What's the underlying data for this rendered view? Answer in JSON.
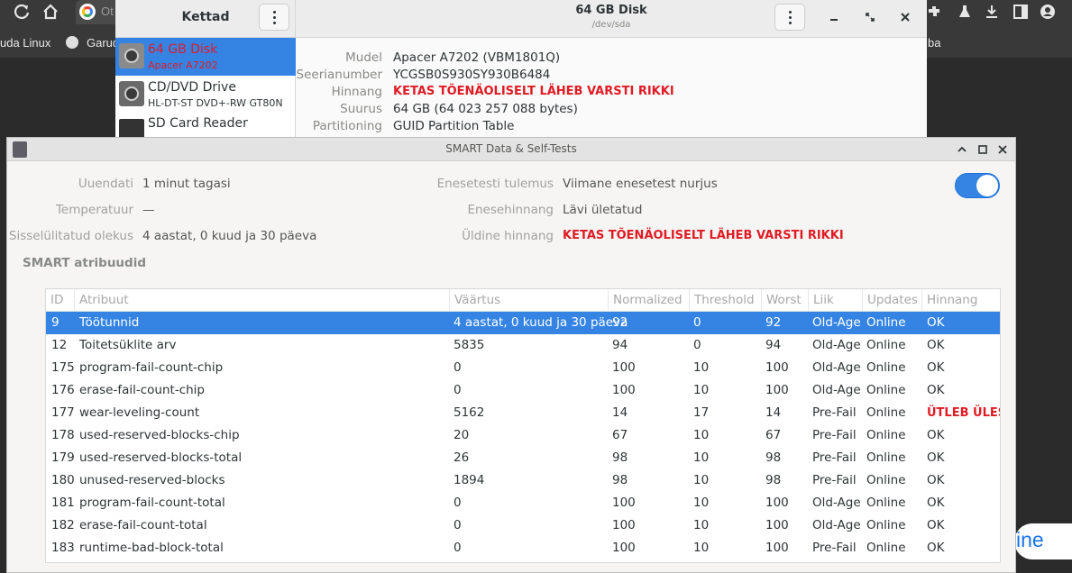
{
  "browser": {
    "tab_label": "Ot",
    "bookmarks": [
      {
        "label": "uda Linux"
      },
      {
        "label": "Garud"
      }
    ],
    "bookmark_right": "ba",
    "bg_chip_text": "ine"
  },
  "disks": {
    "sidebar_title": "Kettad",
    "drive_title": "64 GB Disk",
    "drive_path": "/dev/sda",
    "drives": [
      {
        "name": "64 GB Disk",
        "sub": "Apacer A7202"
      },
      {
        "name": "CD/DVD Drive",
        "sub": "HL-DT-ST DVD+-RW GT80N"
      },
      {
        "name": "SD Card Reader",
        "sub": ""
      }
    ],
    "properties": [
      {
        "label": "Mudel",
        "value": "Apacer A7202 (VBM1801Q)"
      },
      {
        "label": "Seerianumber",
        "value": "YCGSB0S930SY930B6484"
      },
      {
        "label": "Hinnang",
        "value": "KETAS TÕENÄOLISELT LÄHEB VARSTI RIKKI"
      },
      {
        "label": "Suurus",
        "value": "64 GB (64 023 257 088 bytes)"
      },
      {
        "label": "Partitioning",
        "value": "GUID Partition Table"
      }
    ]
  },
  "smart": {
    "title": "SMART Data & Self-Tests",
    "summary_left": [
      {
        "label": "Uuendati",
        "value": "1 minut tagasi"
      },
      {
        "label": "Temperatuur",
        "value": "—"
      },
      {
        "label": "Sisselülitatud olekus",
        "value": "4 aastat, 0 kuud ja 30 päeva"
      }
    ],
    "summary_right": [
      {
        "label": "Enesetesti tulemus",
        "value": "Viimane enesetest nurjus"
      },
      {
        "label": "Enesehinnang",
        "value": "Lävi ületatud"
      },
      {
        "label": "Üldine hinnang",
        "value": "KETAS TÕENÄOLISELT LÄHEB VARSTI RIKKI"
      }
    ],
    "smart_enabled": true,
    "section_title": "SMART atribuudid",
    "columns": {
      "id": "ID",
      "attr": "Atribuut",
      "value": "Väärtus",
      "normalized": "Normalized",
      "threshold": "Threshold",
      "worst": "Worst",
      "type": "Liik",
      "updates": "Updates",
      "assessment": "Hinnang"
    },
    "rows": [
      {
        "id": "9",
        "attr": "Töötunnid",
        "value": "4 aastat, 0 kuud ja 30 päeva",
        "normalized": "92",
        "threshold": "0",
        "worst": "92",
        "type": "Old-Age",
        "updates": "Online",
        "assessment": "OK"
      },
      {
        "id": "12",
        "attr": "Toitetsüklite arv",
        "value": "5835",
        "normalized": "94",
        "threshold": "0",
        "worst": "94",
        "type": "Old-Age",
        "updates": "Online",
        "assessment": "OK"
      },
      {
        "id": "175",
        "attr": "program-fail-count-chip",
        "value": "0",
        "normalized": "100",
        "threshold": "10",
        "worst": "100",
        "type": "Old-Age",
        "updates": "Online",
        "assessment": "OK"
      },
      {
        "id": "176",
        "attr": "erase-fail-count-chip",
        "value": "0",
        "normalized": "100",
        "threshold": "10",
        "worst": "100",
        "type": "Old-Age",
        "updates": "Online",
        "assessment": "OK"
      },
      {
        "id": "177",
        "attr": "wear-leveling-count",
        "value": "5162",
        "normalized": "14",
        "threshold": "17",
        "worst": "14",
        "type": "Pre-Fail",
        "updates": "Online",
        "assessment": "ÜTLEB ÜLES"
      },
      {
        "id": "178",
        "attr": "used-reserved-blocks-chip",
        "value": "20",
        "normalized": "67",
        "threshold": "10",
        "worst": "67",
        "type": "Pre-Fail",
        "updates": "Online",
        "assessment": "OK"
      },
      {
        "id": "179",
        "attr": "used-reserved-blocks-total",
        "value": "26",
        "normalized": "98",
        "threshold": "10",
        "worst": "98",
        "type": "Pre-Fail",
        "updates": "Online",
        "assessment": "OK"
      },
      {
        "id": "180",
        "attr": "unused-reserved-blocks",
        "value": "1894",
        "normalized": "98",
        "threshold": "10",
        "worst": "98",
        "type": "Pre-Fail",
        "updates": "Online",
        "assessment": "OK"
      },
      {
        "id": "181",
        "attr": "program-fail-count-total",
        "value": "0",
        "normalized": "100",
        "threshold": "10",
        "worst": "100",
        "type": "Old-Age",
        "updates": "Online",
        "assessment": "OK"
      },
      {
        "id": "182",
        "attr": "erase-fail-count-total",
        "value": "0",
        "normalized": "100",
        "threshold": "10",
        "worst": "100",
        "type": "Old-Age",
        "updates": "Online",
        "assessment": "OK"
      },
      {
        "id": "183",
        "attr": "runtime-bad-block-total",
        "value": "0",
        "normalized": "100",
        "threshold": "10",
        "worst": "100",
        "type": "Pre-Fail",
        "updates": "Online",
        "assessment": "OK"
      }
    ]
  },
  "colors": {
    "accent": "#3584e4",
    "warning": "#e01b24"
  }
}
